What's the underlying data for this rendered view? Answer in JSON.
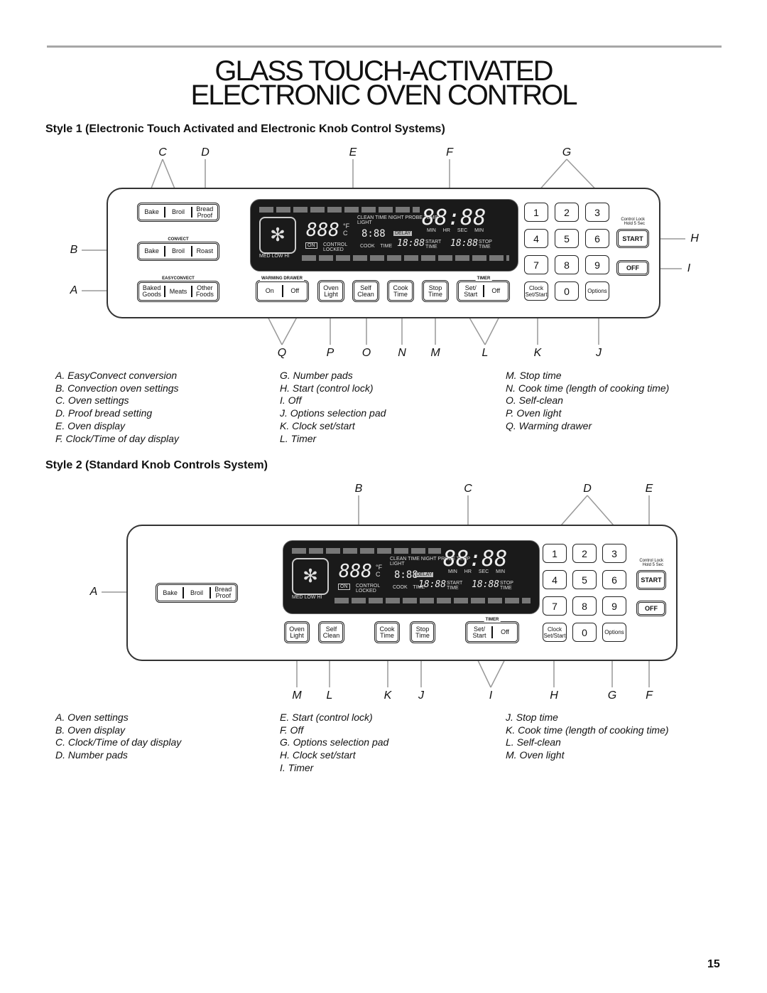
{
  "title": {
    "line1": "GLASS TOUCH-ACTIVATED",
    "line2": "ELECTRONIC OVEN CONTROL"
  },
  "style1": {
    "heading": "Style 1 (Electronic Touch Activated and Electronic Knob Control Systems)",
    "letters": [
      "C",
      "D",
      "E",
      "F",
      "G",
      "B",
      "A",
      "H",
      "I",
      "Q",
      "P",
      "O",
      "N",
      "M",
      "L",
      "K",
      "J"
    ],
    "groups": [
      "CONVECT",
      "EASYCONVECT",
      "WARMING DRAWER",
      "TIMER"
    ],
    "buttons": [
      [
        "Bake",
        "Broil",
        "Bread Proof"
      ],
      [
        "Bake",
        "Broil",
        "Roast"
      ],
      [
        "Baked Goods",
        "Meats",
        "Other Foods"
      ],
      [
        "On",
        "Off"
      ],
      [
        "Oven Light"
      ],
      [
        "Self Clean"
      ],
      [
        "Cook Time"
      ],
      [
        "Stop Time"
      ],
      [
        "Set/ Start",
        "Off"
      ]
    ],
    "keys": [
      "1",
      "2",
      "3",
      "4",
      "5",
      "6",
      "7",
      "8",
      "9",
      "Clock Set/Start",
      "0",
      "Options"
    ],
    "start": "START",
    "off": "OFF",
    "control_lock": "Control Lock Hold 5 Sec",
    "legend": [
      [
        "A. EasyConvect conversion",
        "B. Convection oven settings",
        "C. Oven settings",
        "D. Proof bread setting",
        "E. Oven display",
        "F. Clock/Time of day display"
      ],
      [
        "G. Number pads",
        "H. Start (control lock)",
        "I. Off",
        "J. Options selection pad",
        "K. Clock set/start",
        "L. Timer"
      ],
      [
        "M. Stop time",
        "N. Cook time (length of cooking time)",
        "O. Self-clean",
        "P. Oven light",
        "Q. Warming drawer"
      ]
    ]
  },
  "style2": {
    "heading": "Style 2 (Standard Knob Controls System)",
    "letters": [
      "B",
      "C",
      "D",
      "E",
      "A",
      "M",
      "L",
      "K",
      "J",
      "I",
      "H",
      "G",
      "F"
    ],
    "groups": [
      "TIMER"
    ],
    "buttons": [
      [
        "Bake",
        "Broil",
        "Bread Proof"
      ],
      [
        "Oven Light"
      ],
      [
        "Self Clean"
      ],
      [
        "Cook Time"
      ],
      [
        "Stop Time"
      ],
      [
        "Set/ Start",
        "Off"
      ]
    ],
    "keys": [
      "1",
      "2",
      "3",
      "4",
      "5",
      "6",
      "7",
      "8",
      "9",
      "Clock Set/Start",
      "0",
      "Options"
    ],
    "start": "START",
    "off": "OFF",
    "control_lock": "Control Lock Hold 5 Sec",
    "legend": [
      [
        "A. Oven settings",
        "B. Oven display",
        "C. Clock/Time of day display",
        "D. Number pads"
      ],
      [
        "E. Start (control lock)",
        "F. Off",
        "G. Options selection pad",
        "H. Clock set/start",
        "I. Timer"
      ],
      [
        "J. Stop time",
        "K. Cook time (length of cooking time)",
        "L. Self-clean",
        "M. Oven light"
      ]
    ]
  },
  "display": {
    "clock": "88:88",
    "temp": "888",
    "units": "°F C",
    "labels": "CLEAN TIME NIGHT PROBE TEMP LIGHT",
    "time_units": "MIN HR SEC MIN",
    "small": "8:88",
    "delay": "DELAY",
    "on": "ON",
    "locked": "CONTROL LOCKED",
    "cook_time": "COOK TIME",
    "start_t": "18:88",
    "start_lbl": "START TIME",
    "stop_t": "18:88",
    "stop_lbl": "STOP TIME",
    "fan_levels": "MED LOW HI"
  },
  "page_number": "15"
}
